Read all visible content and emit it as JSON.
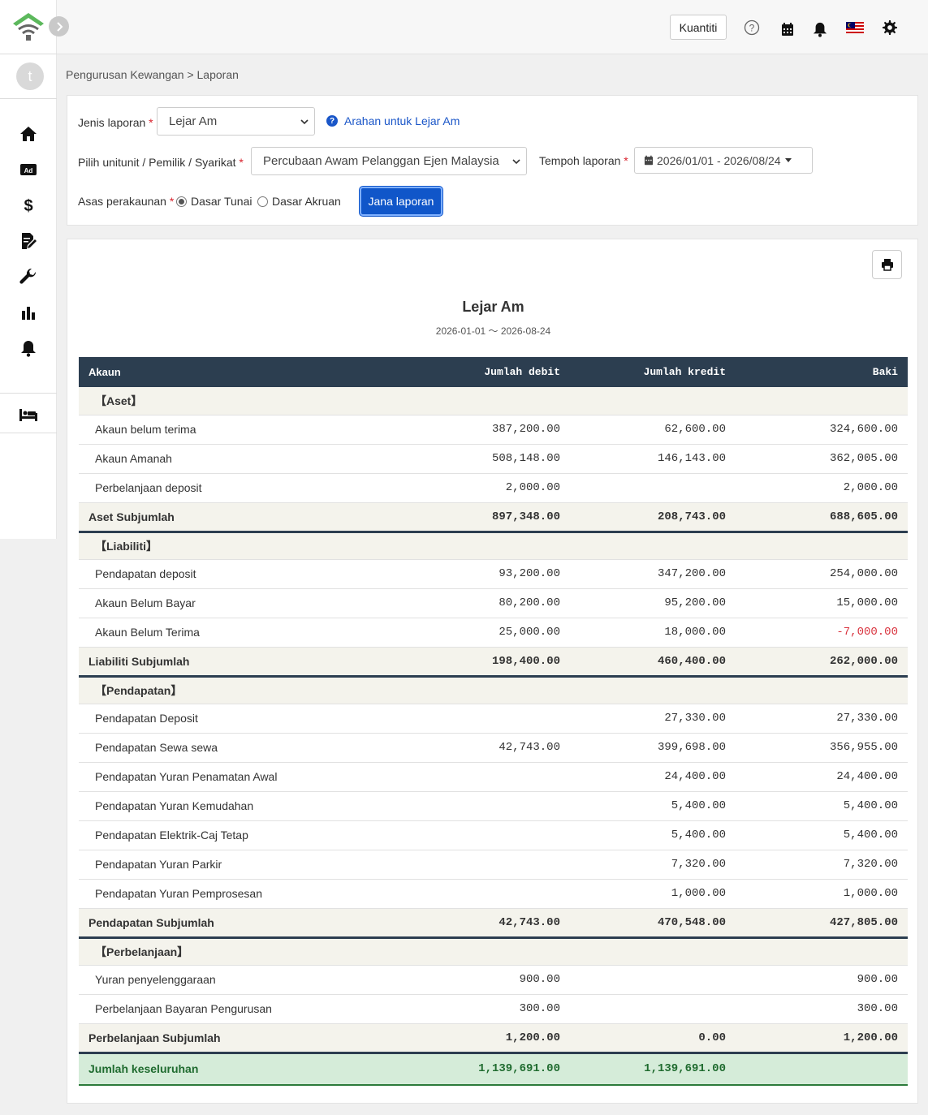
{
  "topbar": {
    "kuantiti_label": "Kuantiti"
  },
  "sidebar": {
    "avatar_letter": "t",
    "items": [
      {
        "icon": "home-icon"
      },
      {
        "icon": "ad-icon",
        "label": "Ad"
      },
      {
        "icon": "dollar-icon",
        "label": "$"
      },
      {
        "icon": "document-edit-icon"
      },
      {
        "icon": "wrench-icon"
      },
      {
        "icon": "bar-chart-icon"
      },
      {
        "icon": "bell-icon"
      },
      {
        "icon": "bed-icon"
      }
    ]
  },
  "breadcrumb": "Pengurusan Kewangan > Laporan",
  "filters": {
    "report_type_label": "Jenis laporan",
    "report_type_value": "Lejar Am",
    "help_link": "Arahan untuk Lejar Am",
    "unit_label": "Pilih unitunit / Pemilik / Syarikat",
    "unit_value": "Percubaan Awam Pelanggan Ejen Malaysia",
    "period_label": "Tempoh laporan",
    "period_value": "2026/01/01 - 2026/08/24",
    "basis_label": "Asas perakaunan",
    "basis_options": [
      "Dasar Tunai",
      "Dasar Akruan"
    ],
    "basis_selected": "Dasar Tunai",
    "generate_label": "Jana laporan"
  },
  "report": {
    "title": "Lejar Am",
    "period": "2026-01-01 〜 2026-08-24",
    "headers": [
      "Akaun",
      "Jumlah debit",
      "Jumlah kredit",
      "Baki"
    ],
    "sections": [
      {
        "category": "【Aset】",
        "rows": [
          {
            "account": "Akaun belum terima",
            "debit": "387,200.00",
            "credit": "62,600.00",
            "balance": "324,600.00"
          },
          {
            "account": "Akaun Amanah",
            "debit": "508,148.00",
            "credit": "146,143.00",
            "balance": "362,005.00"
          },
          {
            "account": "Perbelanjaan deposit",
            "debit": "2,000.00",
            "credit": "",
            "balance": "2,000.00"
          }
        ],
        "subtotal": {
          "label": "Aset Subjumlah",
          "debit": "897,348.00",
          "credit": "208,743.00",
          "balance": "688,605.00"
        }
      },
      {
        "category": "【Liabiliti】",
        "rows": [
          {
            "account": "Pendapatan deposit",
            "debit": "93,200.00",
            "credit": "347,200.00",
            "balance": "254,000.00"
          },
          {
            "account": "Akaun Belum Bayar",
            "debit": "80,200.00",
            "credit": "95,200.00",
            "balance": "15,000.00"
          },
          {
            "account": "Akaun Belum Terima",
            "debit": "25,000.00",
            "credit": "18,000.00",
            "balance": "-7,000.00",
            "negative": true
          }
        ],
        "subtotal": {
          "label": "Liabiliti Subjumlah",
          "debit": "198,400.00",
          "credit": "460,400.00",
          "balance": "262,000.00"
        }
      },
      {
        "category": "【Pendapatan】",
        "rows": [
          {
            "account": "Pendapatan Deposit",
            "debit": "",
            "credit": "27,330.00",
            "balance": "27,330.00"
          },
          {
            "account": "Pendapatan Sewa sewa",
            "debit": "42,743.00",
            "credit": "399,698.00",
            "balance": "356,955.00"
          },
          {
            "account": "Pendapatan Yuran Penamatan Awal",
            "debit": "",
            "credit": "24,400.00",
            "balance": "24,400.00"
          },
          {
            "account": "Pendapatan Yuran Kemudahan",
            "debit": "",
            "credit": "5,400.00",
            "balance": "5,400.00"
          },
          {
            "account": "Pendapatan Elektrik-Caj Tetap",
            "debit": "",
            "credit": "5,400.00",
            "balance": "5,400.00"
          },
          {
            "account": "Pendapatan Yuran Parkir",
            "debit": "",
            "credit": "7,320.00",
            "balance": "7,320.00"
          },
          {
            "account": "Pendapatan Yuran Pemprosesan",
            "debit": "",
            "credit": "1,000.00",
            "balance": "1,000.00"
          }
        ],
        "subtotal": {
          "label": "Pendapatan Subjumlah",
          "debit": "42,743.00",
          "credit": "470,548.00",
          "balance": "427,805.00"
        }
      },
      {
        "category": "【Perbelanjaan】",
        "rows": [
          {
            "account": "Yuran penyelenggaraan",
            "debit": "900.00",
            "credit": "",
            "balance": "900.00"
          },
          {
            "account": "Perbelanjaan Bayaran Pengurusan",
            "debit": "300.00",
            "credit": "",
            "balance": "300.00"
          }
        ],
        "subtotal": {
          "label": "Perbelanjaan Subjumlah",
          "debit": "1,200.00",
          "credit": "0.00",
          "balance": "1,200.00"
        }
      }
    ],
    "grand_total": {
      "label": "Jumlah keseluruhan",
      "debit": "1,139,691.00",
      "credit": "1,139,691.00",
      "balance": ""
    }
  },
  "colors": {
    "header_bg": "#2c3e50",
    "primary": "#1056c9",
    "negative": "#d9343f",
    "total_bg": "#d5ecd9",
    "logo_green": "#5cb85c"
  }
}
